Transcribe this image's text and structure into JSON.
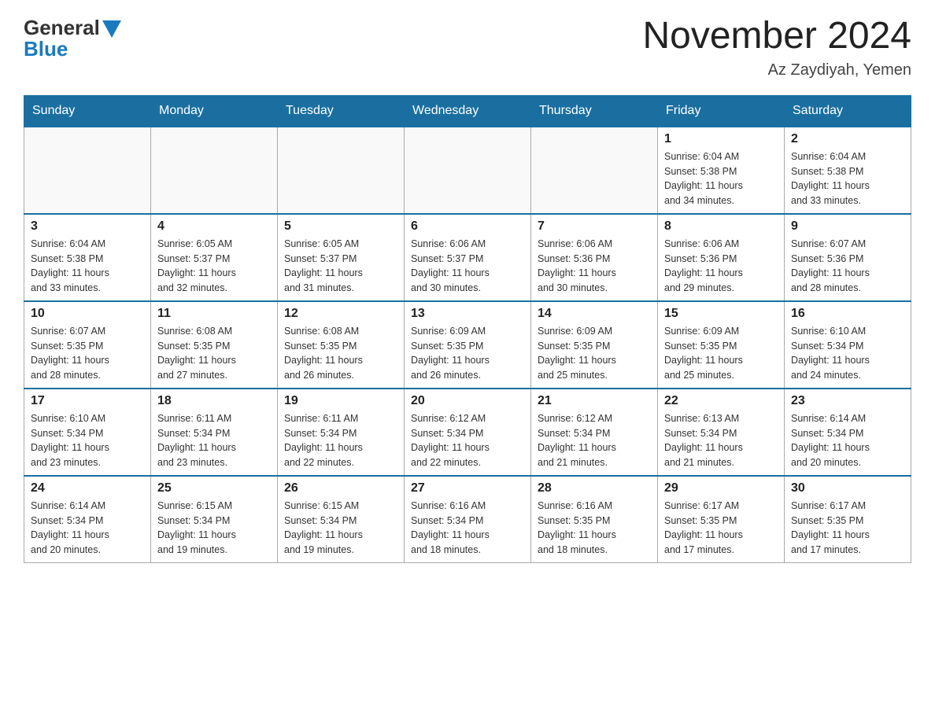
{
  "header": {
    "logo_general": "General",
    "logo_blue": "Blue",
    "title": "November 2024",
    "location": "Az Zaydiyah, Yemen"
  },
  "days_of_week": [
    "Sunday",
    "Monday",
    "Tuesday",
    "Wednesday",
    "Thursday",
    "Friday",
    "Saturday"
  ],
  "weeks": [
    [
      {
        "day": "",
        "info": ""
      },
      {
        "day": "",
        "info": ""
      },
      {
        "day": "",
        "info": ""
      },
      {
        "day": "",
        "info": ""
      },
      {
        "day": "",
        "info": ""
      },
      {
        "day": "1",
        "info": "Sunrise: 6:04 AM\nSunset: 5:38 PM\nDaylight: 11 hours\nand 34 minutes."
      },
      {
        "day": "2",
        "info": "Sunrise: 6:04 AM\nSunset: 5:38 PM\nDaylight: 11 hours\nand 33 minutes."
      }
    ],
    [
      {
        "day": "3",
        "info": "Sunrise: 6:04 AM\nSunset: 5:38 PM\nDaylight: 11 hours\nand 33 minutes."
      },
      {
        "day": "4",
        "info": "Sunrise: 6:05 AM\nSunset: 5:37 PM\nDaylight: 11 hours\nand 32 minutes."
      },
      {
        "day": "5",
        "info": "Sunrise: 6:05 AM\nSunset: 5:37 PM\nDaylight: 11 hours\nand 31 minutes."
      },
      {
        "day": "6",
        "info": "Sunrise: 6:06 AM\nSunset: 5:37 PM\nDaylight: 11 hours\nand 30 minutes."
      },
      {
        "day": "7",
        "info": "Sunrise: 6:06 AM\nSunset: 5:36 PM\nDaylight: 11 hours\nand 30 minutes."
      },
      {
        "day": "8",
        "info": "Sunrise: 6:06 AM\nSunset: 5:36 PM\nDaylight: 11 hours\nand 29 minutes."
      },
      {
        "day": "9",
        "info": "Sunrise: 6:07 AM\nSunset: 5:36 PM\nDaylight: 11 hours\nand 28 minutes."
      }
    ],
    [
      {
        "day": "10",
        "info": "Sunrise: 6:07 AM\nSunset: 5:35 PM\nDaylight: 11 hours\nand 28 minutes."
      },
      {
        "day": "11",
        "info": "Sunrise: 6:08 AM\nSunset: 5:35 PM\nDaylight: 11 hours\nand 27 minutes."
      },
      {
        "day": "12",
        "info": "Sunrise: 6:08 AM\nSunset: 5:35 PM\nDaylight: 11 hours\nand 26 minutes."
      },
      {
        "day": "13",
        "info": "Sunrise: 6:09 AM\nSunset: 5:35 PM\nDaylight: 11 hours\nand 26 minutes."
      },
      {
        "day": "14",
        "info": "Sunrise: 6:09 AM\nSunset: 5:35 PM\nDaylight: 11 hours\nand 25 minutes."
      },
      {
        "day": "15",
        "info": "Sunrise: 6:09 AM\nSunset: 5:35 PM\nDaylight: 11 hours\nand 25 minutes."
      },
      {
        "day": "16",
        "info": "Sunrise: 6:10 AM\nSunset: 5:34 PM\nDaylight: 11 hours\nand 24 minutes."
      }
    ],
    [
      {
        "day": "17",
        "info": "Sunrise: 6:10 AM\nSunset: 5:34 PM\nDaylight: 11 hours\nand 23 minutes."
      },
      {
        "day": "18",
        "info": "Sunrise: 6:11 AM\nSunset: 5:34 PM\nDaylight: 11 hours\nand 23 minutes."
      },
      {
        "day": "19",
        "info": "Sunrise: 6:11 AM\nSunset: 5:34 PM\nDaylight: 11 hours\nand 22 minutes."
      },
      {
        "day": "20",
        "info": "Sunrise: 6:12 AM\nSunset: 5:34 PM\nDaylight: 11 hours\nand 22 minutes."
      },
      {
        "day": "21",
        "info": "Sunrise: 6:12 AM\nSunset: 5:34 PM\nDaylight: 11 hours\nand 21 minutes."
      },
      {
        "day": "22",
        "info": "Sunrise: 6:13 AM\nSunset: 5:34 PM\nDaylight: 11 hours\nand 21 minutes."
      },
      {
        "day": "23",
        "info": "Sunrise: 6:14 AM\nSunset: 5:34 PM\nDaylight: 11 hours\nand 20 minutes."
      }
    ],
    [
      {
        "day": "24",
        "info": "Sunrise: 6:14 AM\nSunset: 5:34 PM\nDaylight: 11 hours\nand 20 minutes."
      },
      {
        "day": "25",
        "info": "Sunrise: 6:15 AM\nSunset: 5:34 PM\nDaylight: 11 hours\nand 19 minutes."
      },
      {
        "day": "26",
        "info": "Sunrise: 6:15 AM\nSunset: 5:34 PM\nDaylight: 11 hours\nand 19 minutes."
      },
      {
        "day": "27",
        "info": "Sunrise: 6:16 AM\nSunset: 5:34 PM\nDaylight: 11 hours\nand 18 minutes."
      },
      {
        "day": "28",
        "info": "Sunrise: 6:16 AM\nSunset: 5:35 PM\nDaylight: 11 hours\nand 18 minutes."
      },
      {
        "day": "29",
        "info": "Sunrise: 6:17 AM\nSunset: 5:35 PM\nDaylight: 11 hours\nand 17 minutes."
      },
      {
        "day": "30",
        "info": "Sunrise: 6:17 AM\nSunset: 5:35 PM\nDaylight: 11 hours\nand 17 minutes."
      }
    ]
  ]
}
